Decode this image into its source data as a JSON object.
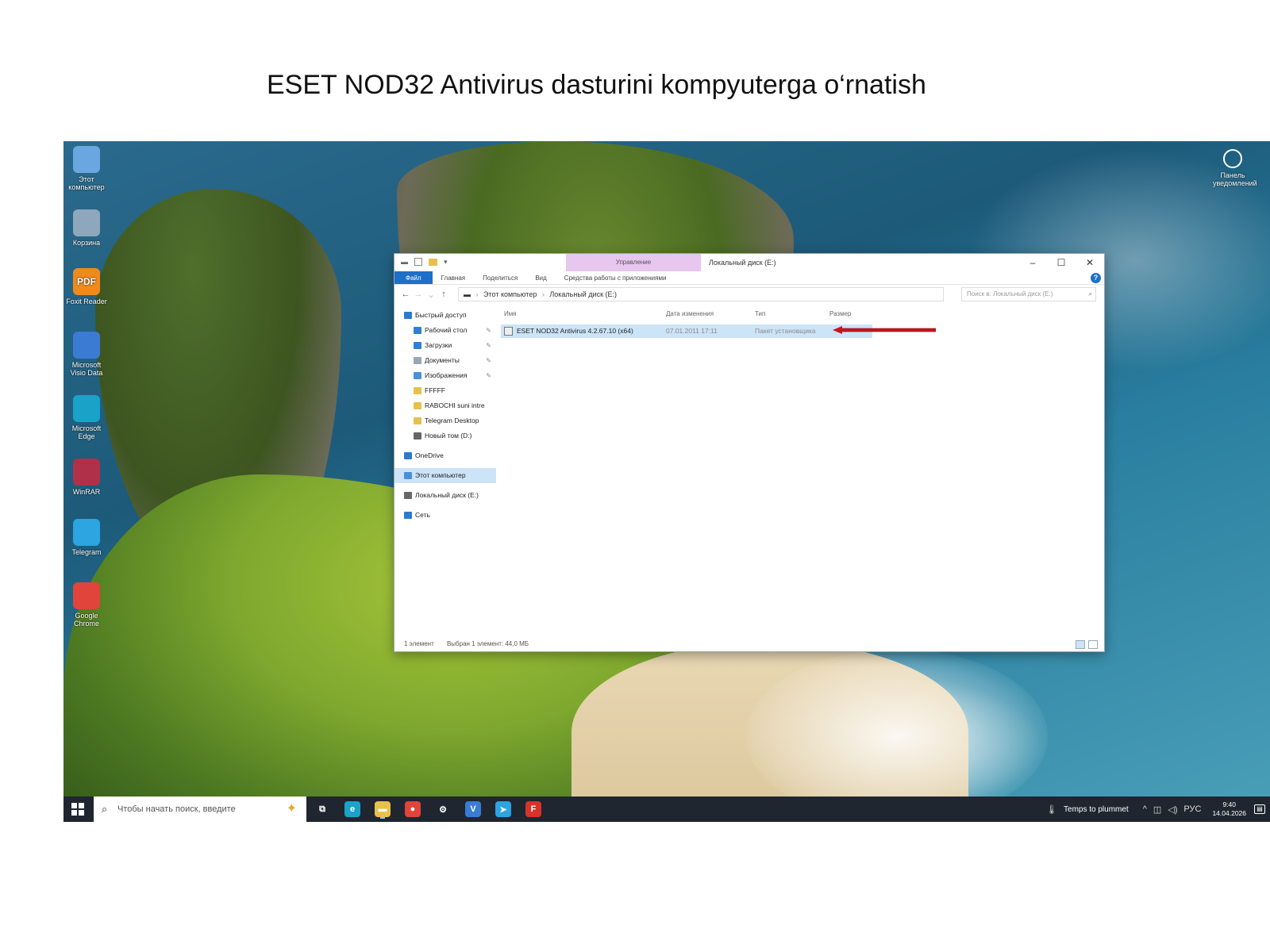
{
  "slide": {
    "title": "ESET NOD32 Antivirus dasturini kompyuterga o‘rnatish"
  },
  "desktop": {
    "icons": [
      {
        "label": "Этот компьютер",
        "icon": "computer-icon",
        "color": "#6aa6e0"
      },
      {
        "label": "Корзина",
        "icon": "recycle-bin-icon",
        "color": "#8fa7bd"
      },
      {
        "label": "Foxit Reader",
        "icon": "pdf-icon",
        "color": "#f08a1c",
        "glyph": "PDF"
      },
      {
        "label": "Microsoft Visio Data",
        "icon": "visio-icon",
        "color": "#3b7bd4"
      },
      {
        "label": "Microsoft Edge",
        "icon": "edge-icon",
        "color": "#1aa2c8"
      },
      {
        "label": "WinRAR",
        "icon": "winrar-icon",
        "color": "#b0304a"
      },
      {
        "label": "Telegram",
        "icon": "telegram-icon",
        "color": "#2ca5e0"
      },
      {
        "label": "Google Chrome",
        "icon": "chrome-icon",
        "color": "#e0443a"
      }
    ],
    "corner_icon": {
      "label": "Панель уведомлений",
      "icon": "user-circle-icon"
    }
  },
  "explorer": {
    "manage_tab": "Управление",
    "title": "Локальный диск (E:)",
    "ribbon_tabs": [
      "Файл",
      "Главная",
      "Поделиться",
      "Вид",
      "Средства работы с приложениями"
    ],
    "address": {
      "root": "Этот компьютер",
      "current": "Локальный диск (E:)"
    },
    "search_placeholder": "Поиск в: Локальный диск (E:)",
    "nav": [
      {
        "label": "Быстрый доступ",
        "icon": "star-icon",
        "color": "#2b79d0",
        "level": "top"
      },
      {
        "label": "Рабочий стол",
        "icon": "desktop-icon",
        "color": "#2f7fd6",
        "level": "sub",
        "pinned": true
      },
      {
        "label": "Загрузки",
        "icon": "download-icon",
        "color": "#2f7fd6",
        "level": "sub",
        "pinned": true
      },
      {
        "label": "Документы",
        "icon": "document-icon",
        "color": "#9aa6b3",
        "level": "sub",
        "pinned": true
      },
      {
        "label": "Изображения",
        "icon": "image-icon",
        "color": "#4a90d9",
        "level": "sub",
        "pinned": true
      },
      {
        "label": "FFFFF",
        "icon": "folder-icon",
        "color": "#e8c04c",
        "level": "sub"
      },
      {
        "label": "RABOCHI suni intre",
        "icon": "folder-icon",
        "color": "#e8c04c",
        "level": "sub"
      },
      {
        "label": "Telegram Desktop",
        "icon": "folder-icon",
        "color": "#e8c04c",
        "level": "sub"
      },
      {
        "label": "Новый том (D:)",
        "icon": "drive-icon",
        "color": "#666666",
        "level": "sub"
      },
      {
        "label": "OneDrive",
        "icon": "cloud-icon",
        "color": "#2b79d0",
        "level": "top"
      },
      {
        "label": "Этот компьютер",
        "icon": "computer-icon",
        "color": "#4a90d9",
        "level": "top",
        "selected": true
      },
      {
        "label": "Локальный диск (E:)",
        "icon": "drive-icon",
        "color": "#666666",
        "level": "top"
      },
      {
        "label": "Сеть",
        "icon": "network-icon",
        "color": "#2b79d0",
        "level": "top"
      }
    ],
    "columns": [
      "Имя",
      "Дата изменения",
      "Тип",
      "Размер"
    ],
    "files": [
      {
        "name": "ESET NOD32 Antivirus 4.2.67.10 (x64)",
        "date": "07.01.2011 17:11",
        "type": "Пакет установщика",
        "size": ""
      }
    ],
    "status": {
      "count": "1 элемент",
      "selected": "Выбран 1 элемент: 44,0 МБ"
    }
  },
  "taskbar": {
    "search_placeholder": "Чтобы начать поиск, введите",
    "apps": [
      {
        "name": "task-view-icon",
        "color": "#1f2630",
        "glyph": "⧉"
      },
      {
        "name": "edge-icon",
        "color": "#1aa2c8",
        "glyph": "e"
      },
      {
        "name": "file-explorer-icon",
        "color": "#e8c04c",
        "glyph": "▬",
        "active": true
      },
      {
        "name": "chrome-icon",
        "color": "#e0443a",
        "glyph": "●"
      },
      {
        "name": "settings-icon",
        "color": "#1f2630",
        "glyph": "⚙"
      },
      {
        "name": "visio-icon",
        "color": "#3b7bd4",
        "glyph": "V"
      },
      {
        "name": "telegram-icon",
        "color": "#2ca5e0",
        "glyph": "➤"
      },
      {
        "name": "foxit-icon",
        "color": "#d6332a",
        "glyph": "F"
      }
    ],
    "weather": "Temps to plummet",
    "language": "РУС",
    "time": "9:40",
    "date": "14.04.2026"
  }
}
